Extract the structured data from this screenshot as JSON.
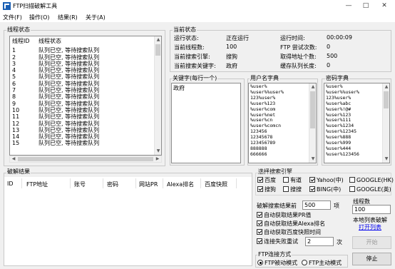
{
  "window": {
    "title": "FTP扫描破解工具",
    "minimize": "—",
    "maximize": "□",
    "close": "✕"
  },
  "menu": [
    "文件(F)",
    "操作(O)",
    "结果(R)",
    "关于(A)"
  ],
  "thread_status": {
    "title": "线程状态",
    "columns": [
      "线程ID",
      "线程状态"
    ],
    "rows": [
      {
        "id": "1",
        "status": "队列已空, 等待搜索队列"
      },
      {
        "id": "2",
        "status": "队列已空, 等待搜索队列"
      },
      {
        "id": "3",
        "status": "队列已空, 等待搜索队列"
      },
      {
        "id": "4",
        "status": "队列已空, 等待搜索队列"
      },
      {
        "id": "5",
        "status": "队列已空, 等待搜索队列"
      },
      {
        "id": "6",
        "status": "队列已空, 等待搜索队列"
      },
      {
        "id": "7",
        "status": "队列已空, 等待搜索队列"
      },
      {
        "id": "8",
        "status": "队列已空, 等待搜索队列"
      },
      {
        "id": "9",
        "status": "队列已空, 等待搜索队列"
      },
      {
        "id": "10",
        "status": "队列已空, 等待搜索队列"
      },
      {
        "id": "11",
        "status": "队列已空, 等待搜索队列"
      },
      {
        "id": "12",
        "status": "队列已空, 等待搜索队列"
      },
      {
        "id": "13",
        "status": "队列已空, 等待搜索队列"
      },
      {
        "id": "14",
        "status": "队列已空, 等待搜索队列"
      },
      {
        "id": "15",
        "status": "队列已空, 等待搜索队列"
      }
    ]
  },
  "current_status": {
    "title": "当前状态",
    "left": [
      {
        "label": "运行状态:",
        "value": "正在运行"
      },
      {
        "label": "当前线程数:",
        "value": "100"
      },
      {
        "label": "当前搜索引擎:",
        "value": "搜狗"
      },
      {
        "label": "当前搜索关键字:",
        "value": "政府"
      }
    ],
    "right": [
      {
        "label": "运行时间:",
        "value": "00:00:09"
      },
      {
        "label": "FTP 尝试次数:",
        "value": "0"
      },
      {
        "label": "取得地址个数:",
        "value": "500"
      },
      {
        "label": "缓存队列长度:",
        "value": "0"
      }
    ]
  },
  "keywords": {
    "title": "关键字(每行一个)",
    "lines": [
      "政府"
    ]
  },
  "username_dict": {
    "title": "用户名字典",
    "lines": [
      "%user%",
      "%user%%user%",
      "123%user%",
      "%user%123",
      "%user%com",
      "%user%net",
      "%user%cn",
      "%user%comcn",
      "123456",
      "12345678",
      "123456789",
      "888888",
      "666666"
    ]
  },
  "password_dict": {
    "title": "密码字典",
    "lines": [
      "%user%",
      "%user%%user%",
      "123%user%",
      "%user%abc",
      "%user%!@#",
      "%user%123",
      "%user%111",
      "%user%1234",
      "%user%12345",
      "%user%888",
      "%user%999",
      "%user%444",
      "%user%123456"
    ]
  },
  "results": {
    "title": "破解结果",
    "columns": [
      "ID",
      "FTP地址",
      "账号",
      "密码",
      "网站PR",
      "Alexa排名",
      "百度快照"
    ]
  },
  "engines": {
    "title": "选择搜索引擎",
    "items": [
      {
        "label": "百度",
        "checked": true
      },
      {
        "label": "有道",
        "checked": false
      },
      {
        "label": "Yahoo(中)",
        "checked": true
      },
      {
        "label": "GOOGLE(HK)",
        "checked": false
      },
      {
        "label": "搜狗",
        "checked": true
      },
      {
        "label": "搜搜",
        "checked": false
      },
      {
        "label": "BING(中)",
        "checked": true
      },
      {
        "label": "GOOGLE(英)",
        "checked": false
      }
    ]
  },
  "thread_count": {
    "label": "线程数",
    "value": "100"
  },
  "search_limit": {
    "label": "破解搜索结果前",
    "value": "500",
    "unit": "项"
  },
  "options": [
    {
      "label": "自动获取结果PR值",
      "checked": true
    },
    {
      "label": "自动获取结果Alexa排名",
      "checked": true
    },
    {
      "label": "自动获取百度快照时间",
      "checked": true
    }
  ],
  "retry": {
    "label": "连接失败重试",
    "value": "2",
    "unit": "次",
    "checked": true
  },
  "local_list": {
    "label": "本地列表破解",
    "link": "打开列表"
  },
  "ftp_mode": {
    "title": "FTP连接方式",
    "passive": {
      "label": "FTP被动模式",
      "selected": true
    },
    "active": {
      "label": "FTP主动模式",
      "selected": false
    }
  },
  "buttons": {
    "start": "开始",
    "stop": "停止"
  },
  "colors": {
    "link": "#0000ee",
    "window_bg": "#f0f0f0"
  }
}
